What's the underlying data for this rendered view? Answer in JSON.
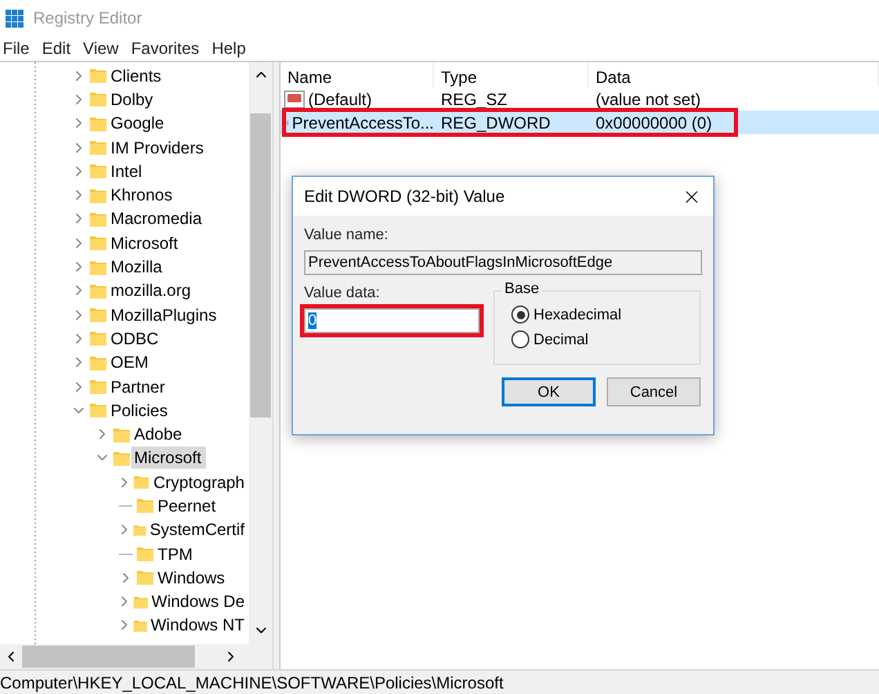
{
  "window": {
    "title": "Registry Editor"
  },
  "menu": [
    "File",
    "Edit",
    "View",
    "Favorites",
    "Help"
  ],
  "tree": [
    {
      "label": "Clients",
      "expandable": true,
      "expanded": false,
      "selected": false
    },
    {
      "label": "Dolby",
      "expandable": true,
      "expanded": false,
      "selected": false
    },
    {
      "label": "Google",
      "expandable": true,
      "expanded": false,
      "selected": false
    },
    {
      "label": "IM Providers",
      "expandable": true,
      "expanded": false,
      "selected": false
    },
    {
      "label": "Intel",
      "expandable": true,
      "expanded": false,
      "selected": false
    },
    {
      "label": "Khronos",
      "expandable": true,
      "expanded": false,
      "selected": false
    },
    {
      "label": "Macromedia",
      "expandable": true,
      "expanded": false,
      "selected": false
    },
    {
      "label": "Microsoft",
      "expandable": true,
      "expanded": false,
      "selected": false
    },
    {
      "label": "Mozilla",
      "expandable": true,
      "expanded": false,
      "selected": false
    },
    {
      "label": "mozilla.org",
      "expandable": true,
      "expanded": false,
      "selected": false
    },
    {
      "label": "MozillaPlugins",
      "expandable": true,
      "expanded": false,
      "selected": false
    },
    {
      "label": "ODBC",
      "expandable": true,
      "expanded": false,
      "selected": false
    },
    {
      "label": "OEM",
      "expandable": true,
      "expanded": false,
      "selected": false
    },
    {
      "label": "Partner",
      "expandable": true,
      "expanded": false,
      "selected": false
    },
    {
      "label": "Policies",
      "expandable": true,
      "expanded": true,
      "selected": false,
      "children": [
        {
          "label": "Adobe",
          "expandable": true,
          "expanded": false,
          "selected": false
        },
        {
          "label": "Microsoft",
          "expandable": true,
          "expanded": true,
          "selected": true,
          "children": [
            {
              "label": "Cryptograph",
              "expandable": true,
              "expanded": false,
              "selected": false
            },
            {
              "label": "Peernet",
              "expandable": false,
              "selected": false
            },
            {
              "label": "SystemCertif",
              "expandable": true,
              "expanded": false,
              "selected": false
            },
            {
              "label": "TPM",
              "expandable": false,
              "selected": false
            },
            {
              "label": "Windows",
              "expandable": true,
              "expanded": false,
              "selected": false
            },
            {
              "label": "Windows De",
              "expandable": true,
              "expanded": false,
              "selected": false
            },
            {
              "label": "Windows NT",
              "expandable": true,
              "expanded": false,
              "selected": false
            }
          ]
        }
      ]
    }
  ],
  "values": {
    "columns": [
      "Name",
      "Type",
      "Data"
    ],
    "rows": [
      {
        "kind": "string",
        "name": "(Default)",
        "type": "REG_SZ",
        "data": "(value not set)",
        "selected": false,
        "highlighted": false
      },
      {
        "kind": "dword",
        "name": "PreventAccessTo...",
        "type": "REG_DWORD",
        "data": "0x00000000 (0)",
        "selected": true,
        "highlighted": true
      }
    ]
  },
  "dialog": {
    "title": "Edit DWORD (32-bit) Value",
    "value_name_label": "Value name:",
    "value_name": "PreventAccessToAboutFlagsInMicrosoftEdge",
    "value_data_label": "Value data:",
    "value_data": "0",
    "value_data_highlighted": true,
    "base_label": "Base",
    "bases": [
      {
        "label": "Hexadecimal",
        "selected": true
      },
      {
        "label": "Decimal",
        "selected": false
      }
    ],
    "buttons": [
      {
        "label": "OK",
        "default": true
      },
      {
        "label": "Cancel",
        "default": false
      }
    ]
  },
  "status_bar": "Computer\\HKEY_LOCAL_MACHINE\\SOFTWARE\\Policies\\Microsoft"
}
